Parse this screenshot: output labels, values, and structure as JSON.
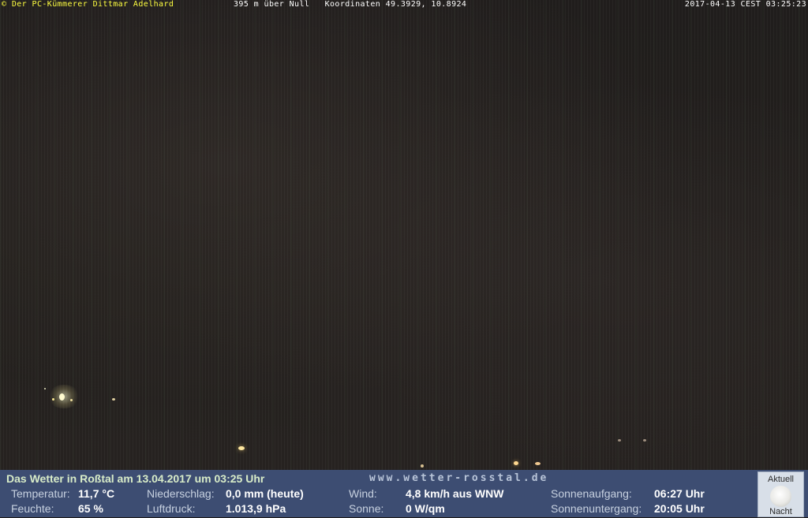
{
  "overlay": {
    "left": "© Der PC-Kümmerer Dittmar Adelhard",
    "middle": "395 m über Null   Koordinaten 49.3929, 10.8924",
    "right": "2017-04-13 CEST 03:25:23"
  },
  "panel": {
    "title": "Das Wetter in Roßtal am 13.04.2017 um 03:25 Uhr",
    "url": "www.wetter-rosstal.de",
    "temperature_label": "Temperatur:",
    "temperature_value": "11,7 °C",
    "humidity_label": "Feuchte:",
    "humidity_value": "65 %",
    "precip_label": "Niederschlag:",
    "precip_value": "0,0 mm (heute)",
    "pressure_label": "Luftdruck:",
    "pressure_value": "1.013,9 hPa",
    "wind_label": "Wind:",
    "wind_value": "4,8 km/h aus WNW",
    "sun_label": "Sonne:",
    "sun_value": "0 W/qm",
    "sunrise_label": "Sonnenaufgang:",
    "sunrise_value": "06:27 Uhr",
    "sunset_label": "Sonnenuntergang:",
    "sunset_value": "20:05 Uhr",
    "moon_top": "Aktuell",
    "moon_bottom": "Nacht"
  },
  "colors": {
    "panel_bg": "#3d4d72",
    "overlay_credit": "#ffff40",
    "title_text": "#d8ecc8"
  }
}
